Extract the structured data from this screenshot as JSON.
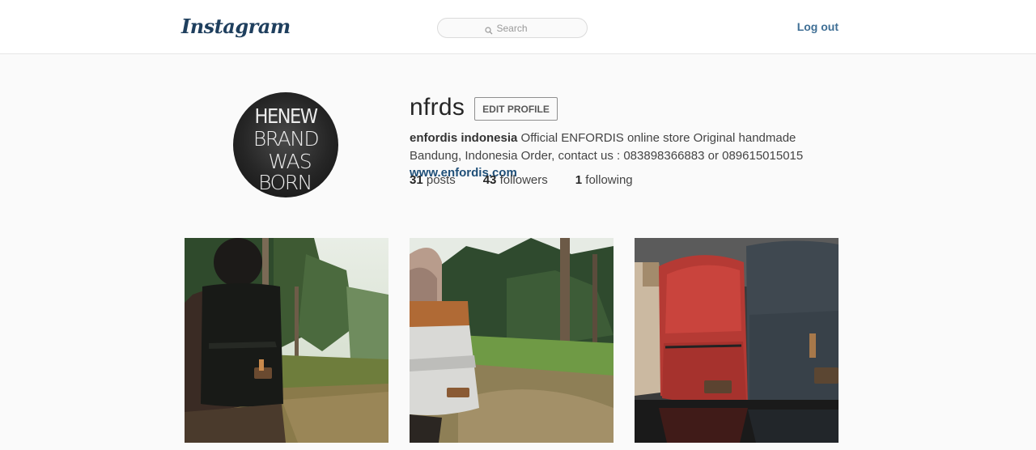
{
  "header": {
    "logo_text": "Instagram",
    "search_placeholder": "Search",
    "logout_label": "Log out"
  },
  "profile": {
    "username": "nfrds",
    "edit_button_label": "EDIT PROFILE",
    "full_name": "enfordis indonesia",
    "bio_text": "Official ENFORDIS online store Original handmade Bandung, Indonesia Order, contact us : 083898366883 or 089615015015",
    "website": "www.enfordis.com",
    "avatar_lines": [
      "HENEW",
      "BRAND",
      "WAS",
      "BORN"
    ],
    "stats": {
      "posts_count": "31",
      "posts_label": "posts",
      "followers_count": "43",
      "followers_label": "followers",
      "following_count": "1",
      "following_label": "following"
    }
  },
  "photos": [
    {
      "name": "person-with-black-backpack-in-forest"
    },
    {
      "name": "person-with-grey-brown-backpack-on-trail"
    },
    {
      "name": "red-and-grey-backpacks"
    }
  ],
  "colors": {
    "logo": "#1f3f5e",
    "link": "#3f6f95",
    "text": "#262626"
  }
}
